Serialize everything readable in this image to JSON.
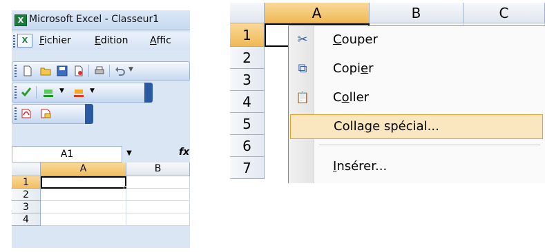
{
  "window": {
    "title": "Microsoft Excel - Classeur1",
    "logo_letter": "X"
  },
  "menubar": {
    "icon_letter": "X",
    "items": [
      "Fichier",
      "Edition",
      "Affic"
    ]
  },
  "namebox": {
    "value": "A1",
    "fx_label": "fx"
  },
  "left_grid": {
    "columns": [
      "A",
      "B"
    ],
    "rows": [
      "1",
      "2",
      "3",
      "4"
    ],
    "selected_cell": "A1"
  },
  "right_grid": {
    "columns": [
      "A",
      "B",
      "C"
    ],
    "rows": [
      "1",
      "2",
      "3",
      "4",
      "5",
      "6",
      "7"
    ]
  },
  "context_menu": {
    "items": [
      {
        "label": "Couper",
        "icon": "scissors-icon",
        "glyph": "✂"
      },
      {
        "label": "Copier",
        "icon": "copy-icon",
        "glyph": "⧉"
      },
      {
        "label": "Coller",
        "icon": "paste-icon",
        "glyph": "📋"
      },
      {
        "label": "Collage spécial...",
        "highlighted": true
      },
      {
        "label": "Insérer..."
      }
    ]
  },
  "colors": {
    "selection_header": "#f1bf62",
    "menu_highlight": "#fbe7bf",
    "menu_highlight_border": "#e6a02c"
  }
}
